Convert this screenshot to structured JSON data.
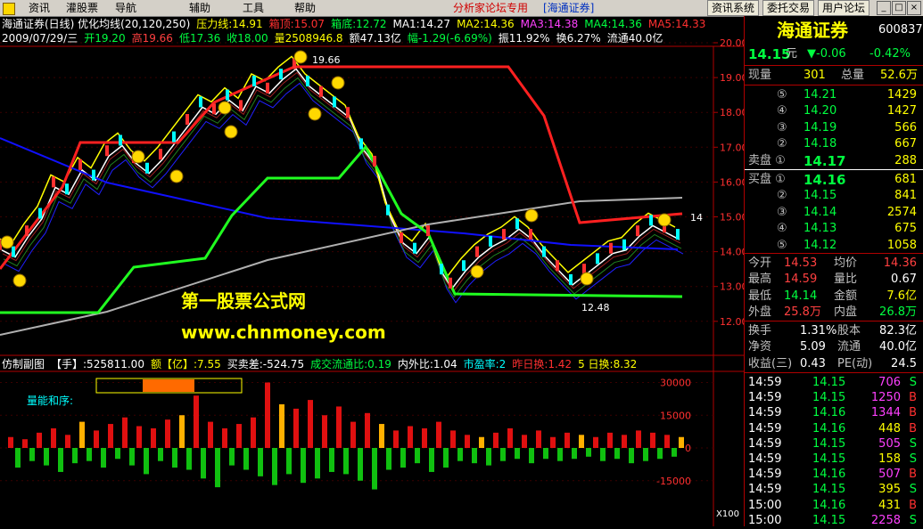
{
  "menu": {
    "items": [
      "资讯",
      "灌股票",
      "导航",
      "辅助",
      "工具",
      "帮助"
    ],
    "promo": "分析家论坛专用",
    "promo_brand": "[海通证券]",
    "toolbar_buttons": [
      "资讯系统",
      "委托交易",
      "用户论坛"
    ]
  },
  "main_header": {
    "line1": [
      {
        "text": "海通证券(日线) 优化均线(20,120,250)",
        "color": "#ffffff"
      },
      {
        "text": "压力线:14.91",
        "color": "#ffff00"
      },
      {
        "text": "箱顶:15.07",
        "color": "#ff3030"
      },
      {
        "text": "箱底:12.72",
        "color": "#00ff40"
      },
      {
        "text": "MA1:14.27",
        "color": "#ffffff"
      },
      {
        "text": "MA2:14.36",
        "color": "#ffff00"
      },
      {
        "text": "MA3:14.38",
        "color": "#ff40ff"
      },
      {
        "text": "MA4:14.36",
        "color": "#00ff40"
      },
      {
        "text": "MA5:14.33",
        "color": "#ff3030"
      }
    ],
    "line2": [
      {
        "text": "2009/07/29/三",
        "color": "#ffffff"
      },
      {
        "text": "开19.20",
        "color": "#00ff40"
      },
      {
        "text": "高19.66",
        "color": "#ff4040"
      },
      {
        "text": "低17.36",
        "color": "#00ff40"
      },
      {
        "text": "收18.00",
        "color": "#00ff40"
      },
      {
        "text": "量2508946.8",
        "color": "#ffff00"
      },
      {
        "text": "额47.13亿",
        "color": "#ffffff"
      },
      {
        "text": "幅-1.29(-6.69%)",
        "color": "#00ff40"
      },
      {
        "text": "振11.92%",
        "color": "#ffffff"
      },
      {
        "text": "换6.27%",
        "color": "#ffffff"
      },
      {
        "text": "流通40.0亿",
        "color": "#ffffff"
      }
    ]
  },
  "price_axis": [
    "20.00",
    "19.00",
    "18.00",
    "17.00",
    "16.00",
    "15.00",
    "14.00",
    "13.00",
    "12.00"
  ],
  "price_annotations": {
    "high": "19.66",
    "low": "12.48",
    "right": "14"
  },
  "watermark": {
    "site_name": "第一股票公式网",
    "url": "www.chnmoney.com"
  },
  "sub_header": [
    {
      "text": "仿制副图",
      "color": "#ffffff"
    },
    {
      "text": "【手】:525811.00",
      "color": "#ffffff"
    },
    {
      "text": "额【亿】:7.55",
      "color": "#ffff00"
    },
    {
      "text": "买卖差:-524.75",
      "color": "#ffffff"
    },
    {
      "text": "成交流通比:0.19",
      "color": "#00ff40"
    },
    {
      "text": "内外比:1.04",
      "color": "#ffffff"
    },
    {
      "text": "市盈率:2",
      "color": "#00ffff"
    },
    {
      "text": "昨日换:1.42",
      "color": "#ff3030"
    },
    {
      "text": "5 日换:8.32",
      "color": "#ffff00"
    }
  ],
  "sub_label": "量能和序:",
  "volume_axis": [
    "30000",
    "15000",
    "0",
    "-15000"
  ],
  "volume_unit": "X100",
  "quote": {
    "name": "海通证券",
    "code": "600837",
    "price": "14.15",
    "price_unit": "元",
    "change": "▼-0.06",
    "change_pct": "-0.42%",
    "now_vol_label": "现量",
    "now_vol": "301",
    "total_vol_label": "总量",
    "total_vol": "52.6万",
    "sells": [
      {
        "label": "⑤",
        "price": "14.21",
        "vol": "1429"
      },
      {
        "label": "④",
        "price": "14.20",
        "vol": "1427"
      },
      {
        "label": "③",
        "price": "14.19",
        "vol": "566"
      },
      {
        "label": "②",
        "price": "14.18",
        "vol": "667"
      },
      {
        "label": "卖盘 ①",
        "price": "14.17",
        "vol": "288"
      }
    ],
    "buys": [
      {
        "label": "买盘 ①",
        "price": "14.16",
        "vol": "681"
      },
      {
        "label": "②",
        "price": "14.15",
        "vol": "841"
      },
      {
        "label": "③",
        "price": "14.14",
        "vol": "2574"
      },
      {
        "label": "④",
        "price": "14.13",
        "vol": "675"
      },
      {
        "label": "⑤",
        "price": "14.12",
        "vol": "1058"
      }
    ],
    "stats": [
      {
        "l1": "今开",
        "v1": "14.53",
        "c1": "#ff4040",
        "l2": "均价",
        "v2": "14.36",
        "c2": "#ff4040"
      },
      {
        "l1": "最高",
        "v1": "14.59",
        "c1": "#ff4040",
        "l2": "量比",
        "v2": "0.67",
        "c2": "#ffffff"
      },
      {
        "l1": "最低",
        "v1": "14.14",
        "c1": "#00ff40",
        "l2": "金额",
        "v2": "7.6亿",
        "c2": "#ffff00"
      },
      {
        "l1": "外盘",
        "v1": "25.8万",
        "c1": "#ff4040",
        "l2": "内盘",
        "v2": "26.8万",
        "c2": "#00ff40"
      }
    ],
    "fin": [
      {
        "l1": "换手",
        "v1": "1.31%",
        "l2": "股本",
        "v2": "82.3亿"
      },
      {
        "l1": "净资",
        "v1": "5.09",
        "l2": "流通",
        "v2": "40.0亿"
      },
      {
        "l1": "收益(三)",
        "v1": "0.43",
        "l2": "PE(动)",
        "v2": "24.5"
      }
    ],
    "ticks": [
      {
        "time": "14:59",
        "price": "14.15",
        "vol": "706",
        "side": "S",
        "vc": "#ff40ff"
      },
      {
        "time": "14:59",
        "price": "14.15",
        "vol": "1250",
        "side": "B",
        "vc": "#ff40ff"
      },
      {
        "time": "14:59",
        "price": "14.16",
        "vol": "1344",
        "side": "B",
        "vc": "#ff40ff"
      },
      {
        "time": "14:59",
        "price": "14.16",
        "vol": "448",
        "side": "B",
        "vc": "#ffff00"
      },
      {
        "time": "14:59",
        "price": "14.15",
        "vol": "505",
        "side": "S",
        "vc": "#ff40ff"
      },
      {
        "time": "14:59",
        "price": "14.15",
        "vol": "158",
        "side": "S",
        "vc": "#ffff00"
      },
      {
        "time": "14:59",
        "price": "14.16",
        "vol": "507",
        "side": "B",
        "vc": "#ff40ff"
      },
      {
        "time": "14:59",
        "price": "14.15",
        "vol": "395",
        "side": "S",
        "vc": "#ffff00"
      },
      {
        "time": "15:00",
        "price": "14.16",
        "vol": "431",
        "side": "B",
        "vc": "#ffff00"
      },
      {
        "time": "15:00",
        "price": "14.15",
        "vol": "2258",
        "side": "S",
        "vc": "#ff40ff"
      }
    ]
  },
  "price_path": [
    [
      0,
      14.2
    ],
    [
      15,
      14.0
    ],
    [
      30,
      14.6
    ],
    [
      45,
      15.1
    ],
    [
      60,
      16.0
    ],
    [
      75,
      15.8
    ],
    [
      90,
      16.5
    ],
    [
      105,
      16.2
    ],
    [
      120,
      16.9
    ],
    [
      135,
      17.2
    ],
    [
      150,
      16.7
    ],
    [
      165,
      16.4
    ],
    [
      180,
      16.8
    ],
    [
      195,
      17.3
    ],
    [
      210,
      17.8
    ],
    [
      225,
      18.3
    ],
    [
      240,
      18.1
    ],
    [
      255,
      18.5
    ],
    [
      270,
      18.2
    ],
    [
      285,
      18.9
    ],
    [
      300,
      18.7
    ],
    [
      315,
      19.1
    ],
    [
      330,
      19.4
    ],
    [
      345,
      18.9
    ],
    [
      360,
      18.6
    ],
    [
      375,
      18.3
    ],
    [
      390,
      18.0
    ],
    [
      405,
      17.1
    ],
    [
      420,
      16.6
    ],
    [
      435,
      15.2
    ],
    [
      450,
      14.4
    ],
    [
      465,
      14.1
    ],
    [
      480,
      14.6
    ],
    [
      495,
      13.5
    ],
    [
      505,
      13.1
    ],
    [
      520,
      13.6
    ],
    [
      535,
      14.0
    ],
    [
      550,
      14.3
    ],
    [
      565,
      14.5
    ],
    [
      580,
      14.8
    ],
    [
      595,
      14.5
    ],
    [
      610,
      14.0
    ],
    [
      625,
      13.6
    ],
    [
      640,
      13.2
    ],
    [
      655,
      13.5
    ],
    [
      670,
      13.8
    ],
    [
      685,
      14.1
    ],
    [
      700,
      14.2
    ],
    [
      715,
      14.6
    ],
    [
      730,
      14.9
    ],
    [
      745,
      14.7
    ],
    [
      760,
      14.5
    ]
  ],
  "volume_bars": [
    [
      12,
      5000
    ],
    [
      20,
      -9000
    ],
    [
      28,
      4000
    ],
    [
      36,
      -6000
    ],
    [
      44,
      7000
    ],
    [
      52,
      -8000
    ],
    [
      60,
      9000
    ],
    [
      68,
      -11000
    ],
    [
      76,
      6000
    ],
    [
      84,
      -7000
    ],
    [
      92,
      12000
    ],
    [
      100,
      -6000
    ],
    [
      108,
      8000
    ],
    [
      116,
      -9000
    ],
    [
      124,
      11000
    ],
    [
      132,
      -5000
    ],
    [
      140,
      14000
    ],
    [
      148,
      -8000
    ],
    [
      156,
      10000
    ],
    [
      164,
      -12000
    ],
    [
      172,
      9000
    ],
    [
      180,
      -6000
    ],
    [
      188,
      13000
    ],
    [
      196,
      -9000
    ],
    [
      204,
      15000
    ],
    [
      212,
      -10000
    ],
    [
      220,
      24000
    ],
    [
      228,
      -14000
    ],
    [
      236,
      12000
    ],
    [
      244,
      -18000
    ],
    [
      252,
      9000
    ],
    [
      260,
      -8000
    ],
    [
      268,
      11000
    ],
    [
      276,
      -10000
    ],
    [
      284,
      14000
    ],
    [
      292,
      -13000
    ],
    [
      300,
      30000
    ],
    [
      308,
      -17000
    ],
    [
      316,
      20000
    ],
    [
      324,
      -12000
    ],
    [
      332,
      18000
    ],
    [
      340,
      -16000
    ],
    [
      348,
      22000
    ],
    [
      356,
      -14000
    ],
    [
      364,
      15000
    ],
    [
      372,
      -11000
    ],
    [
      380,
      19000
    ],
    [
      388,
      -12000
    ],
    [
      396,
      12000
    ],
    [
      404,
      -15000
    ],
    [
      412,
      16000
    ],
    [
      420,
      -19000
    ],
    [
      428,
      11000
    ],
    [
      436,
      -10000
    ],
    [
      444,
      8000
    ],
    [
      452,
      -9000
    ],
    [
      460,
      10000
    ],
    [
      468,
      -7000
    ],
    [
      476,
      9000
    ],
    [
      484,
      -11000
    ],
    [
      492,
      12000
    ],
    [
      500,
      -9000
    ],
    [
      508,
      8000
    ],
    [
      516,
      -6000
    ],
    [
      524,
      6000
    ],
    [
      532,
      -7000
    ],
    [
      540,
      5000
    ],
    [
      548,
      -8000
    ],
    [
      556,
      7000
    ],
    [
      564,
      -6000
    ],
    [
      572,
      9000
    ],
    [
      580,
      -5000
    ],
    [
      588,
      6000
    ],
    [
      596,
      -7000
    ],
    [
      604,
      8000
    ],
    [
      612,
      -5000
    ],
    [
      620,
      5000
    ],
    [
      628,
      -6000
    ],
    [
      636,
      7000
    ],
    [
      644,
      -5000
    ],
    [
      652,
      6000
    ],
    [
      660,
      -4000
    ],
    [
      668,
      5000
    ],
    [
      676,
      -6000
    ],
    [
      684,
      7000
    ],
    [
      692,
      -5000
    ],
    [
      700,
      6000
    ],
    [
      708,
      -7000
    ],
    [
      716,
      8000
    ],
    [
      724,
      -6000
    ],
    [
      732,
      7000
    ],
    [
      740,
      -5000
    ],
    [
      748,
      6000
    ],
    [
      756,
      -4000
    ],
    [
      764,
      5000
    ]
  ]
}
